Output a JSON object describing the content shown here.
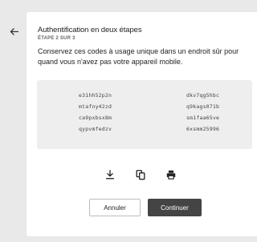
{
  "header": {
    "back_icon": "arrow-left-icon"
  },
  "dialog": {
    "title": "Authentification en deux étapes",
    "step": "ÉTAPE 2 SUR 3",
    "description": "Conservez ces codes à usage unique dans un endroit sûr pour quand vous n'avez pas votre appareil mobile."
  },
  "codes": [
    "e31hh52p2n",
    "dkv7qg5hbc",
    "mtafny42zd",
    "q9kags071b",
    "ca9pxbsx8m",
    "sm1faa65ve",
    "qypvmfedzv",
    "6xsmm25996"
  ],
  "actions": {
    "download_icon": "download-icon",
    "copy_icon": "copy-icon",
    "print_icon": "printer-icon"
  },
  "buttons": {
    "cancel_label": "Annuler",
    "continue_label": "Continuer"
  },
  "colors": {
    "background": "#e9e9e9",
    "card": "#ffffff",
    "codes_box": "#eeeeee",
    "primary_button": "#444444"
  }
}
